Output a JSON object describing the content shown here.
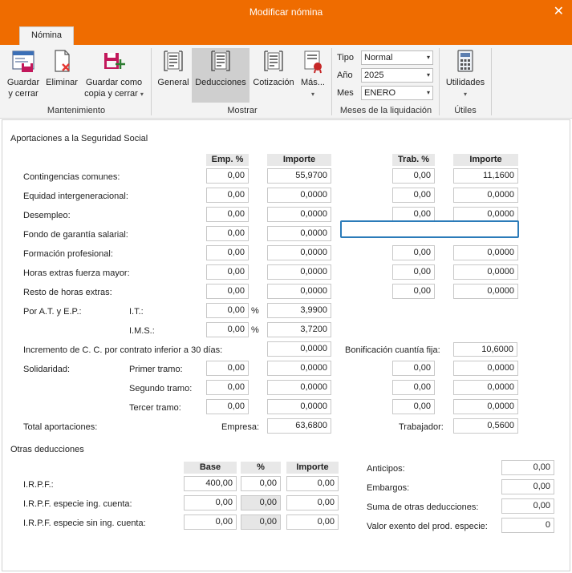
{
  "window": {
    "title": "Modificar nómina",
    "close_glyph": "✕"
  },
  "tabs": [
    {
      "label": "Nómina",
      "active": true
    }
  ],
  "ribbon": {
    "mantenimiento": {
      "label": "Mantenimiento",
      "guardar_cerrar": {
        "line1": "Guardar",
        "line2": "y cerrar",
        "icon": "save-window-icon"
      },
      "eliminar": {
        "line1": "Eliminar",
        "icon": "delete-document-icon"
      },
      "guardar_copia": {
        "line1": "Guardar como",
        "line2": "copia y cerrar",
        "caret": "▾",
        "icon": "save-copy-icon"
      }
    },
    "mostrar": {
      "label": "Mostrar",
      "general": {
        "label": "General",
        "icon": "document-list-icon"
      },
      "deducciones": {
        "label": "Deducciones",
        "icon": "document-list-icon",
        "active": true
      },
      "cotizacion": {
        "label": "Cotización",
        "icon": "document-list-icon"
      },
      "mas": {
        "label": "Más...",
        "caret": "▾",
        "icon": "certificate-icon"
      }
    },
    "meses": {
      "label": "Meses de la liquidación",
      "tipo": {
        "label": "Tipo",
        "value": "Normal"
      },
      "anio": {
        "label": "Año",
        "value": "2025"
      },
      "mes": {
        "label": "Mes",
        "value": "ENERO"
      },
      "arrow": "▾"
    },
    "utiles": {
      "label": "Útiles",
      "utilidades": {
        "label": "Utilidades",
        "caret": "▾",
        "icon": "calculator-icon"
      }
    }
  },
  "seg_social": {
    "section_title": "Aportaciones a la Seguridad Social",
    "headers": {
      "emp_pct": "Emp. %",
      "importe": "Importe",
      "trab_pct": "Trab. %",
      "importe2": "Importe"
    },
    "rows": {
      "contingencias": {
        "label": "Contingencias comunes:",
        "emp_pct": "0,00",
        "importe": "55,9700",
        "trab_pct": "0,00",
        "importe_trab": "11,1600"
      },
      "equidad": {
        "label": "Equidad intergeneracional:",
        "emp_pct": "0,00",
        "importe": "0,0000",
        "trab_pct": "0,00",
        "importe_trab": "0,0000"
      },
      "desempleo": {
        "label": "Desempleo:",
        "emp_pct": "0,00",
        "importe": "0,0000",
        "trab_pct": "0,00",
        "importe_trab": "0,0000"
      },
      "fondo": {
        "label": "Fondo de garantía salarial:",
        "emp_pct": "0,00",
        "importe": "0,0000"
      },
      "formacion": {
        "label": "Formación profesional:",
        "emp_pct": "0,00",
        "importe": "0,0000",
        "trab_pct": "0,00",
        "importe_trab": "0,0000"
      },
      "horas_fm": {
        "label": "Horas extras fuerza mayor:",
        "emp_pct": "0,00",
        "importe": "0,0000",
        "trab_pct": "0,00",
        "importe_trab": "0,0000"
      },
      "resto_horas": {
        "label": "Resto de horas extras:",
        "emp_pct": "0,00",
        "importe": "0,0000",
        "trab_pct": "0,00",
        "importe_trab": "0,0000"
      }
    },
    "at_ep": {
      "label": "Por A.T. y E.P.:",
      "it": {
        "label": "I.T.:",
        "pct": "0,00",
        "pct_sign": "%",
        "importe": "3,9900"
      },
      "ims": {
        "label": "I.M.S.:",
        "pct": "0,00",
        "pct_sign": "%",
        "importe": "3,7200"
      }
    },
    "incremento": {
      "label": "Incremento de C. C. por contrato inferior a 30 días:",
      "importe": "0,0000"
    },
    "bonificacion": {
      "label": "Bonificación cuantía fija:",
      "value": "10,6000"
    },
    "solidaridad": {
      "label": "Solidaridad:",
      "primer": {
        "label": "Primer tramo:",
        "emp_pct": "0,00",
        "importe": "0,0000",
        "trab_pct": "0,00",
        "importe_trab": "0,0000"
      },
      "segundo": {
        "label": "Segundo tramo:",
        "emp_pct": "0,00",
        "importe": "0,0000",
        "trab_pct": "0,00",
        "importe_trab": "0,0000"
      },
      "tercer": {
        "label": "Tercer tramo:",
        "emp_pct": "0,00",
        "importe": "0,0000",
        "trab_pct": "0,00",
        "importe_trab": "0,0000"
      }
    },
    "total": {
      "label": "Total aportaciones:",
      "empresa_label": "Empresa:",
      "empresa": "63,6800",
      "trabajador_label": "Trabajador:",
      "trabajador": "0,5600"
    }
  },
  "otras": {
    "section_title": "Otras deducciones",
    "headers": {
      "base": "Base",
      "pct": "%",
      "importe": "Importe"
    },
    "irpf": {
      "label": "I.R.P.F.:",
      "base": "400,00",
      "pct": "0,00",
      "importe": "0,00"
    },
    "irpf_con": {
      "label": "I.R.P.F. especie ing. cuenta:",
      "base": "0,00",
      "pct": "0,00",
      "importe": "0,00"
    },
    "irpf_sin": {
      "label": "I.R.P.F. especie sin ing. cuenta:",
      "base": "0,00",
      "pct": "0,00",
      "importe": "0,00"
    },
    "anticipos": {
      "label": "Anticipos:",
      "value": "0,00"
    },
    "embargos": {
      "label": "Embargos:",
      "value": "0,00"
    },
    "suma": {
      "label": "Suma de otras deducciones:",
      "value": "0,00"
    },
    "valor_exento": {
      "label": "Valor exento del prod. especie:",
      "value": "0"
    }
  }
}
